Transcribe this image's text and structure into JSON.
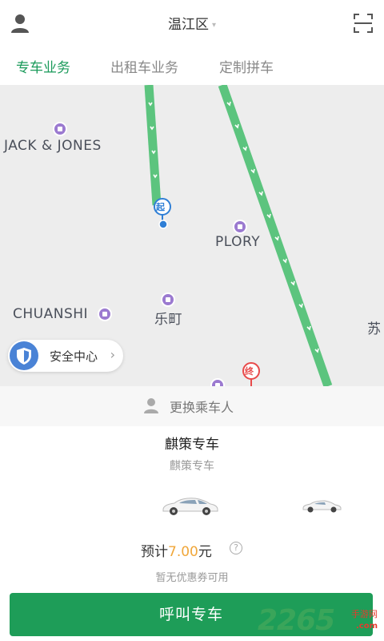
{
  "header": {
    "district": "温江区",
    "user_icon": "user-icon",
    "scan_icon": "scan-icon"
  },
  "tabs": [
    {
      "label": "专车业务",
      "active": true
    },
    {
      "label": "出租车业务",
      "active": false
    },
    {
      "label": "定制拼车",
      "active": false
    }
  ],
  "map": {
    "pois": [
      {
        "label": "JACK & JONES"
      },
      {
        "label": "PLORY"
      },
      {
        "label": "CHUANSHI"
      },
      {
        "label": "乐町"
      },
      {
        "label": "苏"
      }
    ],
    "start_marker": "起",
    "end_marker": "终",
    "safety_center": "安全中心",
    "route_color": "#5cc47e",
    "start_color": "#2f7fd6",
    "end_color": "#e84a4a"
  },
  "sheet": {
    "change_passenger": "更换乘车人",
    "car_type_title": "麒策专车",
    "car_type_subtitle": "麒策专车",
    "price_prefix": "预计",
    "price_amount": "7.00",
    "price_unit": "元",
    "coupon_text": "暂无优惠券可用",
    "call_button": "呼叫专车",
    "accent_color": "#1e9d58",
    "price_color": "#f0a73a"
  },
  "watermark": {
    "number": "2265",
    "site": "手游网",
    "domain": ".com"
  }
}
